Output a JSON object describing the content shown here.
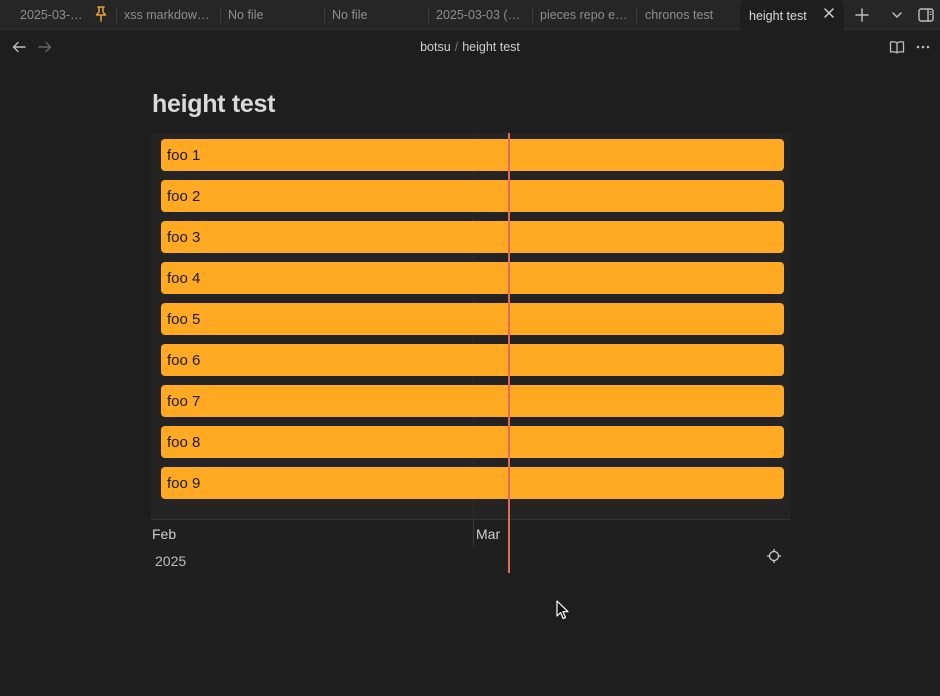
{
  "tabs": [
    {
      "label": "2025-03-…",
      "pinned": true
    },
    {
      "label": "xss markdown…"
    },
    {
      "label": "No file"
    },
    {
      "label": "No file"
    },
    {
      "label": "2025-03-03 (…"
    },
    {
      "label": "pieces repo e…"
    },
    {
      "label": "chronos test"
    },
    {
      "label": "height test",
      "active": true
    }
  ],
  "breadcrumb": {
    "folder": "botsu",
    "separator": "/",
    "file": "height test"
  },
  "note": {
    "title": "height test"
  },
  "timeline": {
    "items": [
      "foo 1",
      "foo 2",
      "foo 3",
      "foo 4",
      "foo 5",
      "foo 6",
      "foo 7",
      "foo 8",
      "foo 9"
    ],
    "axis_labels": {
      "first": "Feb",
      "second": "Mar"
    },
    "year": "2025",
    "colors": {
      "item": "#ffaa22",
      "now_line": "#e46a5b"
    }
  },
  "icons": {
    "pin": "pin-icon",
    "close": "close-icon",
    "new_tab": "plus-icon",
    "tab_list": "chevron-down-icon",
    "sidebar": "sidebar-toggle-icon",
    "back": "arrow-left-icon",
    "forward": "arrow-right-icon",
    "reading": "book-open-icon",
    "more": "more-options-icon",
    "recenter": "target-icon"
  }
}
